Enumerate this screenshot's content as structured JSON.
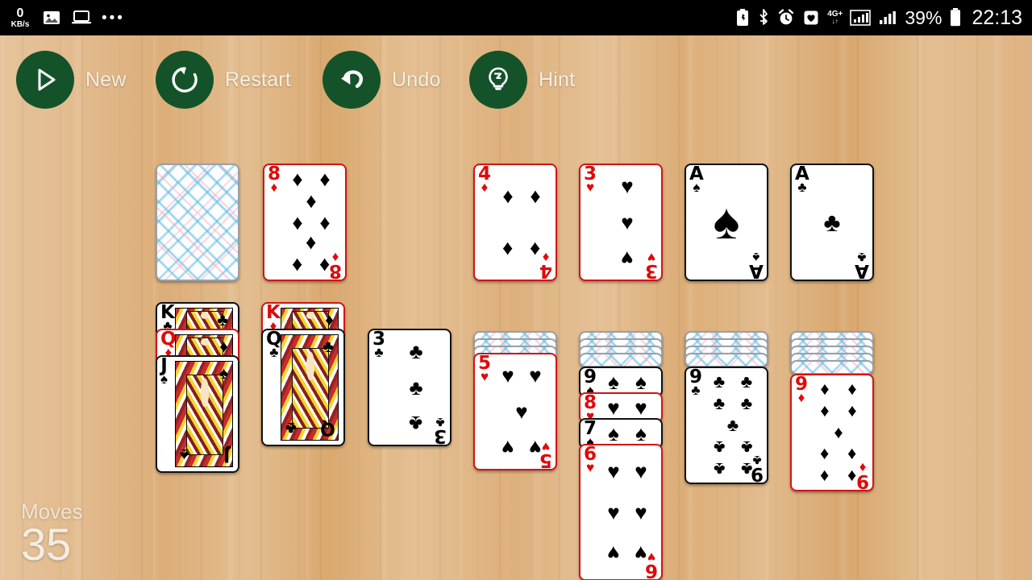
{
  "statusbar": {
    "netspeed_value": "0",
    "netspeed_unit": "KB/s",
    "left_icons": [
      "image-icon",
      "laptop-icon",
      "overflow-dots-icon"
    ],
    "overflow_dots": "•••",
    "right_icons": [
      "battery-saver-icon",
      "bluetooth-icon",
      "alarm-icon",
      "heart-health-icon",
      "mobile-data-4gplus-icon",
      "signal-bars-icon-1",
      "signal-bars-icon-2",
      "battery-icon"
    ],
    "network_label": "4G+",
    "network_sublabel": "↓↑",
    "battery_percent": "39%",
    "time": "22:13"
  },
  "toolbar": {
    "buttons": [
      {
        "label": "New",
        "icon": "play-icon"
      },
      {
        "label": "Restart",
        "icon": "restart-icon"
      },
      {
        "label": "Undo",
        "icon": "undo-icon"
      },
      {
        "label": "Hint",
        "icon": "lightbulb-icon"
      }
    ],
    "circle_color": "#14532a",
    "label_color": "#f3efe2"
  },
  "game": {
    "name": "klondike-solitaire",
    "moves_label": "Moves",
    "moves_count": "35",
    "suit_glyphs": {
      "spades": "♠",
      "hearts": "♥",
      "diamonds": "♦",
      "clubs": "♣"
    },
    "stock": {
      "face_down_count": 1,
      "label": "stock-pile"
    },
    "waste": {
      "rank": "8",
      "suit": "♦",
      "color": "red",
      "pips": 8
    },
    "foundations": [
      {
        "rank": "4",
        "suit": "♦",
        "color": "red",
        "pips": 4
      },
      {
        "rank": "3",
        "suit": "♥",
        "color": "red",
        "pips": 3
      },
      {
        "rank": "A",
        "suit": "♠",
        "color": "black",
        "pips": 1
      },
      {
        "rank": "A",
        "suit": "♣",
        "color": "black",
        "pips": 1
      }
    ],
    "tableau": [
      {
        "column": 1,
        "face_down": 0,
        "cards": [
          {
            "rank": "K",
            "suit": "♣",
            "color": "black",
            "face": true
          },
          {
            "rank": "Q",
            "suit": "♦",
            "color": "red",
            "face": true
          },
          {
            "rank": "J",
            "suit": "♠",
            "color": "black",
            "face": true
          }
        ]
      },
      {
        "column": 2,
        "face_down": 0,
        "cards": [
          {
            "rank": "K",
            "suit": "♦",
            "color": "red",
            "face": true
          },
          {
            "rank": "Q",
            "suit": "♣",
            "color": "black",
            "face": true
          }
        ]
      },
      {
        "column": 3,
        "face_down": 0,
        "cards": [
          {
            "rank": "3",
            "suit": "♣",
            "color": "black",
            "pips": 3
          }
        ]
      },
      {
        "column": 4,
        "face_down": 3,
        "cards": [
          {
            "rank": "5",
            "suit": "♥",
            "color": "red",
            "pips": 5
          }
        ]
      },
      {
        "column": 5,
        "face_down": 4,
        "cards": [
          {
            "rank": "9",
            "suit": "♠",
            "color": "black",
            "pips": 9
          },
          {
            "rank": "8",
            "suit": "♥",
            "color": "red",
            "pips": 8
          },
          {
            "rank": "7",
            "suit": "♠",
            "color": "black",
            "pips": 7
          },
          {
            "rank": "6",
            "suit": "♥",
            "color": "red",
            "pips": 6
          }
        ]
      },
      {
        "column": 6,
        "face_down": 4,
        "cards": [
          {
            "rank": "9",
            "suit": "♣",
            "color": "black",
            "pips": 9
          }
        ]
      },
      {
        "column": 7,
        "face_down": 5,
        "cards": [
          {
            "rank": "9",
            "suit": "♦",
            "color": "red",
            "pips": 9
          }
        ]
      }
    ]
  }
}
